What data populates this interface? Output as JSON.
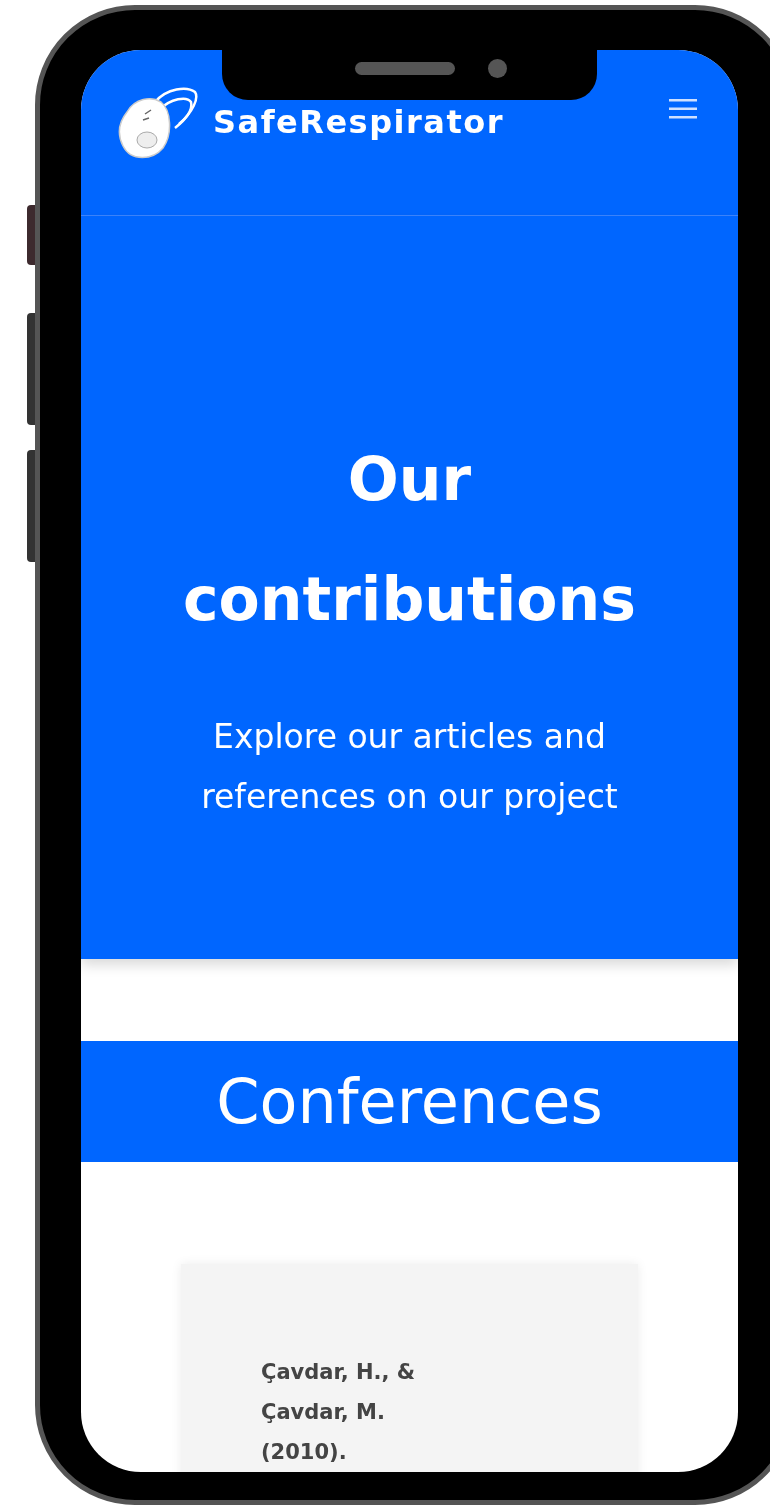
{
  "header": {
    "brand": "SafeRespirator"
  },
  "hero": {
    "title": "Our contributions",
    "subtitle": "Explore our articles and references on our project"
  },
  "section": {
    "heading": "Conferences"
  },
  "references": [
    {
      "text": "Çavdar, H., & Çavdar, M. (2010)."
    }
  ]
}
